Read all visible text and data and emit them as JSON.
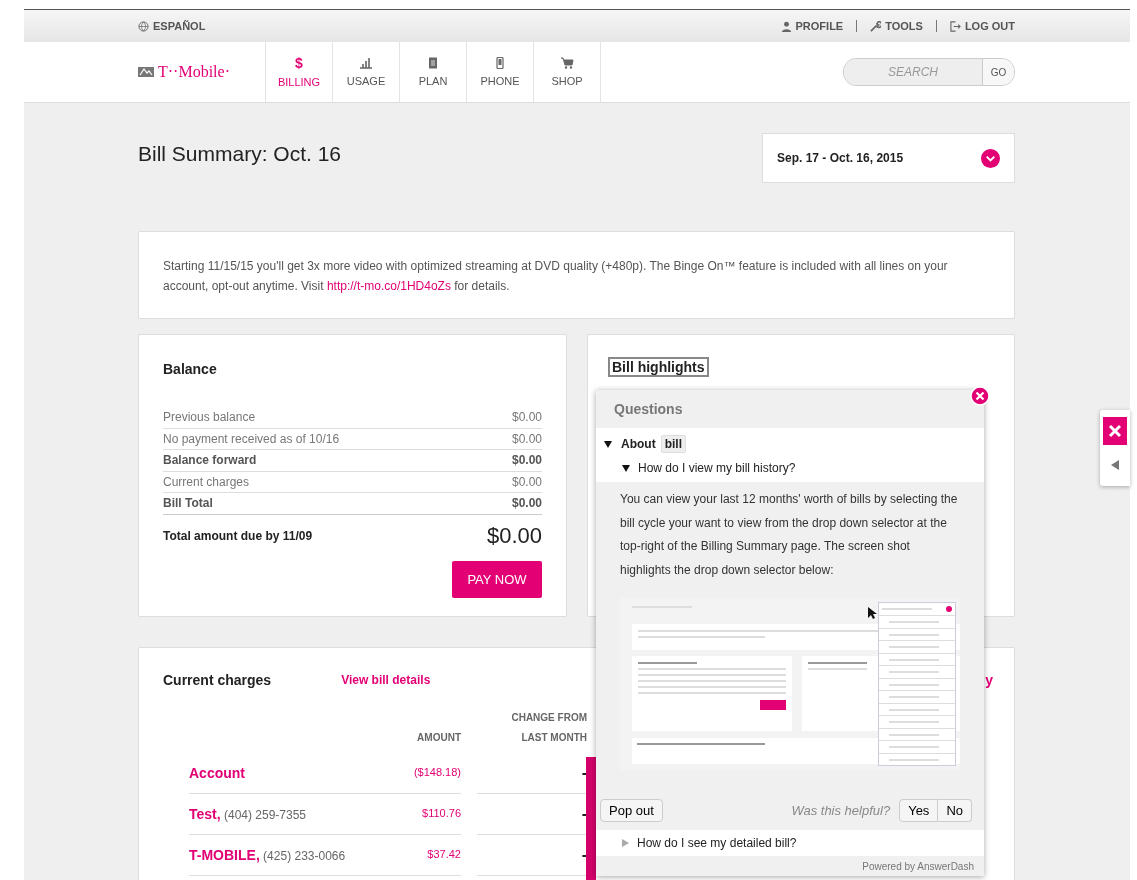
{
  "top_bar": {
    "language": "ESPAÑOL",
    "links": [
      {
        "kind": "profile",
        "label": "PROFILE"
      },
      {
        "kind": "tools",
        "label": "TOOLS"
      },
      {
        "kind": "logout",
        "label": "LOG OUT"
      }
    ]
  },
  "nav": {
    "logo": "T··Mobile·",
    "items": [
      {
        "kind": "billing",
        "icon_text": "$",
        "label": "BILLING",
        "selected": true
      },
      {
        "kind": "usage",
        "label": "USAGE",
        "selected": false
      },
      {
        "kind": "plan",
        "label": "PLAN",
        "selected": false
      },
      {
        "kind": "phone",
        "label": "PHONE",
        "selected": false
      },
      {
        "kind": "shop",
        "label": "SHOP",
        "selected": false
      }
    ],
    "search": {
      "placeholder": "SEARCH",
      "button": "GO"
    }
  },
  "page_title": "Bill Summary: Oct. 16",
  "date_selector": "Sep. 17 - Oct. 16, 2015",
  "notice": {
    "text": "Starting 11/15/15 you'll get 3x more video with optimized streaming at DVD quality (+480p). The Binge On™ feature is included with all lines on your account, opt-out anytime. Visit ",
    "link": "http://t-mo.co/1HD4oZs",
    "after": " for details."
  },
  "balance": {
    "title": "Balance",
    "rows": [
      {
        "label": "Previous balance",
        "value": "$0.00",
        "bold": false
      },
      {
        "label": "No payment received as of 10/16",
        "value": "$0.00",
        "bold": false
      },
      {
        "label": "Balance forward",
        "value": "$0.00",
        "bold": true
      },
      {
        "label": "Current charges",
        "value": "$0.00",
        "bold": false
      },
      {
        "label": "Bill Total",
        "value": "$0.00",
        "bold": true
      }
    ],
    "total_label": "Total amount due by 11/09",
    "total_value": "$0.00",
    "pay_button": "PAY NOW"
  },
  "bill_highlights": {
    "title": "Bill highlights"
  },
  "current_charges": {
    "title": "Current charges",
    "link": "View bill details",
    "cut_link": "y",
    "columns": [
      "AMOUNT",
      "CHANGE FROM LAST MONTH"
    ],
    "rows": [
      {
        "name": "Account",
        "amount": "($148.18)",
        "change": "-"
      },
      {
        "name": "Test,",
        "phone": "(404) 259-7355",
        "amount": "$110.76",
        "change": "-"
      },
      {
        "name": "T-MOBILE,",
        "phone": "(425) 233-0066",
        "amount": "$37.42",
        "change": "-"
      }
    ]
  },
  "help_panel": {
    "title": "Questions",
    "topic": {
      "prefix": "About",
      "tag": "bill",
      "expanded": true
    },
    "questions": [
      {
        "text": "How do I view my bill history?",
        "expanded": true,
        "answer": "You can view your last 12 months' worth of bills by selecting the bill cycle your want to view from the drop down selector at the top-right of the Billing Summary page. The screen shot highlights the drop down selector below:"
      },
      {
        "text": "How do I see my detailed bill?",
        "expanded": false
      }
    ],
    "pop_out": "Pop out",
    "helpful_prompt": "Was this helpful?",
    "yes": "Yes",
    "no": "No",
    "footer": "Powered by AnswerDash"
  }
}
